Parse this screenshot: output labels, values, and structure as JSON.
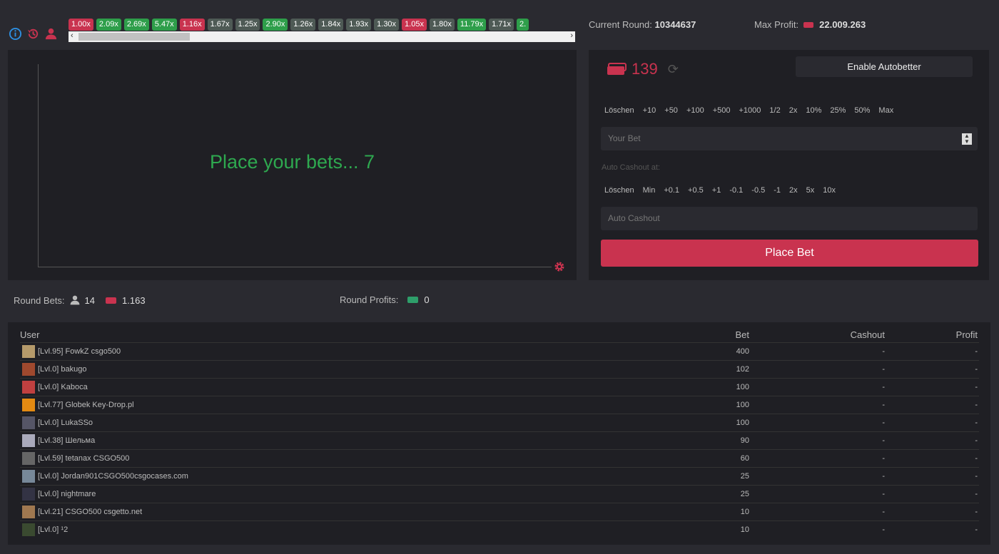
{
  "colors": {
    "red": "#c9334f",
    "green": "#2e9e4a",
    "gray": "#4e5a55",
    "accent": "#2ea84f"
  },
  "header": {
    "icons": [
      "info-icon",
      "history-icon",
      "user-icon"
    ],
    "history": [
      {
        "v": "1.00x",
        "c": "red"
      },
      {
        "v": "2.09x",
        "c": "green"
      },
      {
        "v": "2.69x",
        "c": "green"
      },
      {
        "v": "5.47x",
        "c": "green"
      },
      {
        "v": "1.16x",
        "c": "red"
      },
      {
        "v": "1.67x",
        "c": "gray"
      },
      {
        "v": "1.25x",
        "c": "gray"
      },
      {
        "v": "2.90x",
        "c": "green"
      },
      {
        "v": "1.26x",
        "c": "gray"
      },
      {
        "v": "1.84x",
        "c": "gray"
      },
      {
        "v": "1.93x",
        "c": "gray"
      },
      {
        "v": "1.30x",
        "c": "gray"
      },
      {
        "v": "1.05x",
        "c": "red"
      },
      {
        "v": "1.80x",
        "c": "gray"
      },
      {
        "v": "11.79x",
        "c": "green"
      },
      {
        "v": "1.71x",
        "c": "gray"
      },
      {
        "v": "2.",
        "c": "green"
      }
    ],
    "scroll_left": "‹",
    "scroll_right": "›",
    "current_round_label": "Current Round:",
    "current_round": "10344637",
    "max_profit_label": "Max Profit:",
    "max_profit": "22.009.263"
  },
  "graph": {
    "status": "Place your bets... 7"
  },
  "bet_panel": {
    "balance": "139",
    "autobetter": "Enable Autobetter",
    "bet_quick": [
      "Löschen",
      "+10",
      "+50",
      "+100",
      "+500",
      "+1000",
      "1/2",
      "2x",
      "10%",
      "25%",
      "50%",
      "Max"
    ],
    "bet_placeholder": "Your Bet",
    "auto_label": "Auto Cashout at:",
    "cashout_quick": [
      "Löschen",
      "Min",
      "+0.1",
      "+0.5",
      "+1",
      "-0.1",
      "-0.5",
      "-1",
      "2x",
      "5x",
      "10x"
    ],
    "cashout_placeholder": "Auto Cashout",
    "place_bet": "Place Bet"
  },
  "stats": {
    "round_bets_label": "Round Bets:",
    "players": "14",
    "amount": "1.163",
    "round_profits_label": "Round Profits:",
    "profits": "0"
  },
  "table": {
    "headers": [
      "User",
      "Bet",
      "Cashout",
      "Profit"
    ],
    "rows": [
      {
        "user": "[Lvl.95] FowkZ csgo500",
        "bet": "400",
        "cashout": "-",
        "profit": "-",
        "av": "#b59a6a"
      },
      {
        "user": "[Lvl.0] bakugo",
        "bet": "102",
        "cashout": "-",
        "profit": "-",
        "av": "#a0492e"
      },
      {
        "user": "[Lvl.0] Kaboca",
        "bet": "100",
        "cashout": "-",
        "profit": "-",
        "av": "#c04040"
      },
      {
        "user": "[Lvl.77] Globek Key-Drop.pl",
        "bet": "100",
        "cashout": "-",
        "profit": "-",
        "av": "#e38a12"
      },
      {
        "user": "[Lvl.0] LukaSSo",
        "bet": "100",
        "cashout": "-",
        "profit": "-",
        "av": "#556"
      },
      {
        "user": "[Lvl.38] Шельма",
        "bet": "90",
        "cashout": "-",
        "profit": "-",
        "av": "#aab"
      },
      {
        "user": "[Lvl.59] tetanax CSGO500",
        "bet": "60",
        "cashout": "-",
        "profit": "-",
        "av": "#666"
      },
      {
        "user": "[Lvl.0] Jordan901CSGO500csgocases.com",
        "bet": "25",
        "cashout": "-",
        "profit": "-",
        "av": "#789"
      },
      {
        "user": "[Lvl.0] nightmare",
        "bet": "25",
        "cashout": "-",
        "profit": "-",
        "av": "#334"
      },
      {
        "user": "[Lvl.21] CSGO500 csgetto.net",
        "bet": "10",
        "cashout": "-",
        "profit": "-",
        "av": "#a07850"
      },
      {
        "user": "[Lvl.0] ¹2",
        "bet": "10",
        "cashout": "-",
        "profit": "-",
        "av": "#3a4a30"
      }
    ]
  }
}
